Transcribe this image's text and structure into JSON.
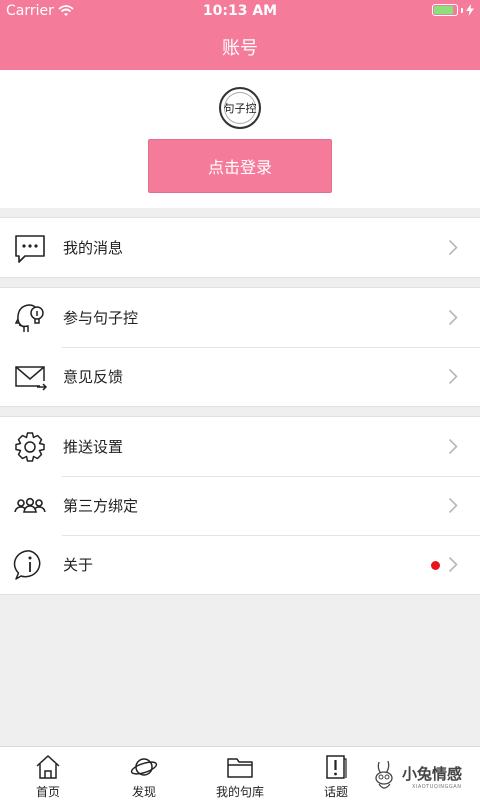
{
  "status_bar": {
    "carrier": "Carrier",
    "time": "10:13 AM",
    "battery_level": 0.85
  },
  "header": {
    "title": "账号"
  },
  "profile": {
    "logo_text": "句子控",
    "login_label": "点击登录"
  },
  "menu": [
    {
      "label": "我的消息",
      "icon": "message-icon"
    },
    {
      "label": "参与句子控",
      "icon": "idea-head-icon"
    },
    {
      "label": "意见反馈",
      "icon": "mail-icon"
    },
    {
      "label": "推送设置",
      "icon": "gear-icon"
    },
    {
      "label": "第三方绑定",
      "icon": "people-icon"
    },
    {
      "label": "关于",
      "icon": "info-icon",
      "has_badge_dot": true
    }
  ],
  "tabbar": [
    {
      "label": "首页",
      "icon": "home-icon"
    },
    {
      "label": "发现",
      "icon": "planet-icon"
    },
    {
      "label": "我的句库",
      "icon": "folder-icon"
    },
    {
      "label": "话题",
      "icon": "topic-icon"
    }
  ],
  "watermark": {
    "text": "小兔情感",
    "sub": "XIAOTUQINGGAN"
  },
  "colors": {
    "accent": "#f57b9a",
    "badge": "#e8141b",
    "background": "#efefef"
  }
}
